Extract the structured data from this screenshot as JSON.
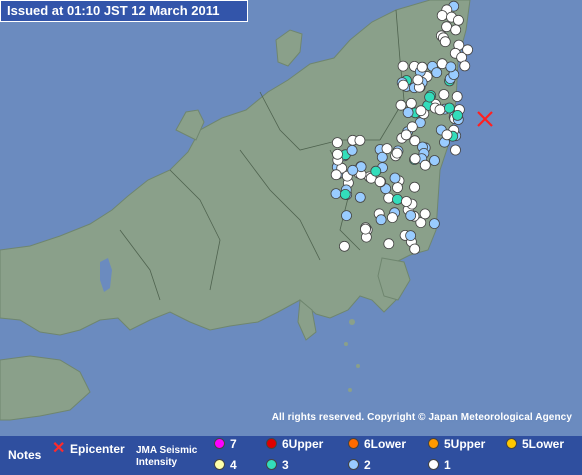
{
  "issued": "Issued at 01:10 JST  12 March 2011",
  "copyright": "All rights reserved. Copyright © Japan Meteorological Agency",
  "legend": {
    "notes": "Notes",
    "epicenter": "Epicenter",
    "jma_line1": "JMA Seismic",
    "jma_line2": "Intensity",
    "levels": [
      {
        "label": "7",
        "color": "#ff00ff"
      },
      {
        "label": "6Upper",
        "color": "#e00000"
      },
      {
        "label": "6Lower",
        "color": "#ff6a00"
      },
      {
        "label": "5Upper",
        "color": "#ff9900"
      },
      {
        "label": "5Lower",
        "color": "#ffc800"
      },
      {
        "label": "4",
        "color": "#ffffaa"
      },
      {
        "label": "3",
        "color": "#33ddbb"
      },
      {
        "label": "2",
        "color": "#99ccff"
      },
      {
        "label": "1",
        "color": "#ffffff"
      }
    ]
  },
  "colors": {
    "sea": "#6b8bbf",
    "land": "#8aa08a",
    "epicenter": "#ff2020",
    "legend_bg": "#2f4f9f"
  },
  "epicenter_icon": "red-x-icon"
}
